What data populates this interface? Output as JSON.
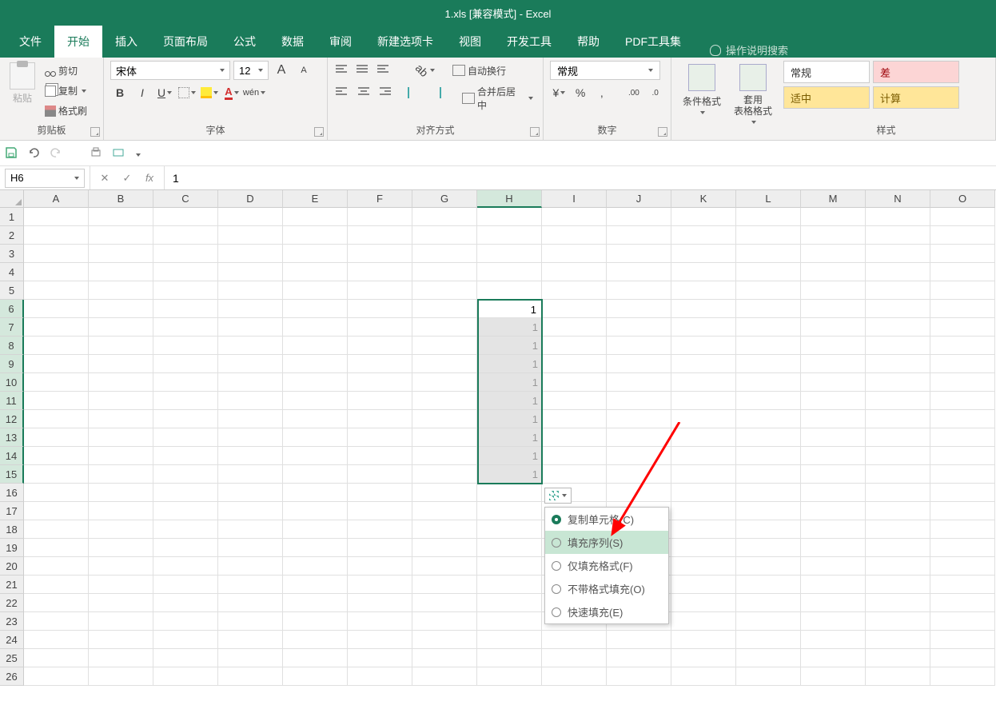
{
  "title": "1.xls  [兼容模式]  -  Excel",
  "tabs": {
    "file": "文件",
    "home": "开始",
    "insert": "插入",
    "page_layout": "页面布局",
    "formulas": "公式",
    "data": "数据",
    "review": "审阅",
    "new_tab": "新建选项卡",
    "view": "视图",
    "dev": "开发工具",
    "help": "帮助",
    "pdf": "PDF工具集",
    "tell_me": "操作说明搜索"
  },
  "ribbon": {
    "clipboard": {
      "label": "剪贴板",
      "paste": "粘贴",
      "cut": "剪切",
      "copy": "复制",
      "format_painter": "格式刷"
    },
    "font": {
      "label": "字体",
      "name": "宋体",
      "size": "12",
      "increase": "A",
      "decrease": "A",
      "bold": "B",
      "italic": "I",
      "underline": "U"
    },
    "alignment": {
      "label": "对齐方式",
      "wrap_text": "自动换行",
      "merge_center": "合并后居中"
    },
    "number": {
      "label": "数字",
      "format": "常规",
      "percent": "%",
      "comma": ","
    },
    "styles": {
      "label": "样式",
      "cond_fmt": "条件格式",
      "format_table": "套用\n表格格式",
      "normal": "常规",
      "bad": "差",
      "good": "适中",
      "calc": "计算"
    }
  },
  "formula_bar": {
    "cell_ref": "H6",
    "value": "1",
    "fx": "fx"
  },
  "columns": [
    "A",
    "B",
    "C",
    "D",
    "E",
    "F",
    "G",
    "H",
    "I",
    "J",
    "K",
    "L",
    "M",
    "N",
    "O"
  ],
  "rows_count": 26,
  "selected_column_index": 7,
  "selected_rows": [
    6,
    7,
    8,
    9,
    10,
    11,
    12,
    13,
    14,
    15
  ],
  "active_cell": "H6",
  "fill_values": [
    "1",
    "1",
    "1",
    "1",
    "1",
    "1",
    "1",
    "1",
    "1",
    "1"
  ],
  "autofill_menu": {
    "copy_cells": "复制单元格(C)",
    "fill_series": "填充序列(S)",
    "fill_formatting": "仅填充格式(F)",
    "fill_without_formatting": "不带格式填充(O)",
    "flash_fill": "快速填充(E)"
  }
}
